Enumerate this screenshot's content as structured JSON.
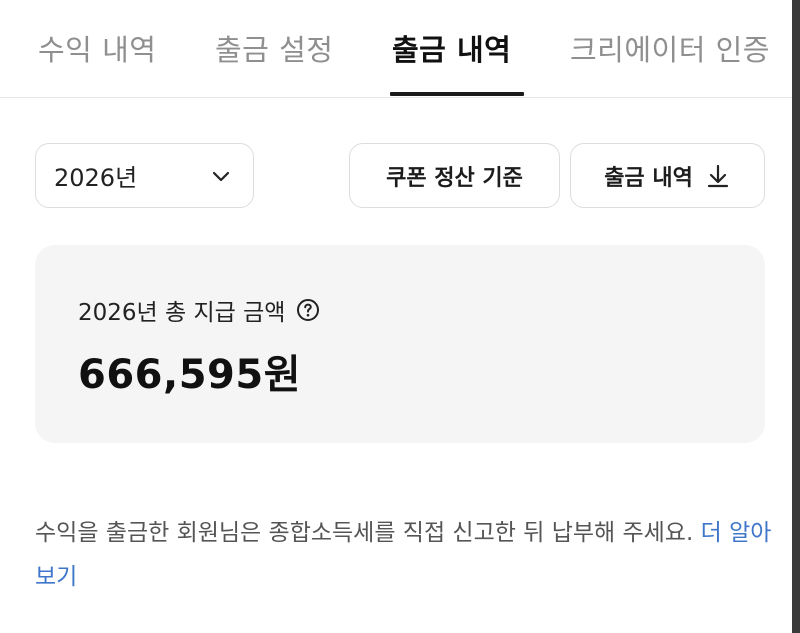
{
  "tabs": [
    {
      "label": "수익 내역",
      "active": false
    },
    {
      "label": "출금 설정",
      "active": false
    },
    {
      "label": "출금 내역",
      "active": true
    },
    {
      "label": "크리에이터 인증",
      "active": false
    }
  ],
  "controls": {
    "year_selected": "2026년",
    "coupon_button_label": "쿠폰 정산 기준",
    "download_button_label": "출금 내역"
  },
  "summary": {
    "label": "2026년 총 지급 금액",
    "amount": "666,595원"
  },
  "notice": {
    "text": "수익을 출금한 회원님은 종합소득세를 직접 신고한 뒤 납부해 주세요.",
    "link_text": "더 알아보기"
  },
  "icons": {
    "dropdown": "chevron-down-icon",
    "download": "download-icon",
    "help": "question-circle-icon"
  },
  "colors": {
    "link": "#3f76c9",
    "card_bg": "#f5f5f5",
    "inactive_tab": "#8f8f8f"
  }
}
